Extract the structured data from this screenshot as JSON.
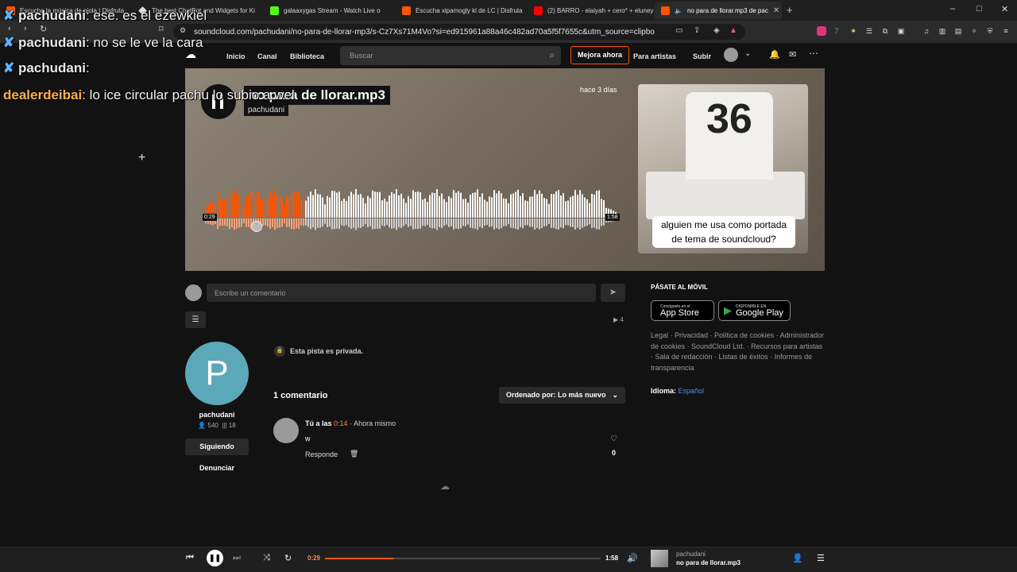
{
  "tabs": [
    {
      "title": "Escucha la música de piola | Disfruta",
      "color": "#ff5500",
      "active": false
    },
    {
      "title": "The best ChatBot and Widgets for Ki",
      "color": "#dddddd",
      "active": false
    },
    {
      "title": "galaaxygas Stream - Watch Live o",
      "color": "#53fc18",
      "active": false
    },
    {
      "title": "Escucha xipamogly kl de LC | Disfruta",
      "color": "#ff5500",
      "active": false
    },
    {
      "title": "(2) BARRO - elaiyah + cero* + eluney",
      "color": "#ff0000",
      "active": false
    },
    {
      "title": "no para de llorar.mp3 de pac",
      "color": "#ff5500",
      "active": true
    }
  ],
  "browser": {
    "new_tab": "+",
    "url": "soundcloud.com/pachudani/no-para-de-llorar-mp3/s-Cz7Xs71M4Vo?si=ed915961a88a46c482ad70a5f5f7655c&utm_source=clipboard&utm_m...",
    "minimize": "–",
    "maximize": "□",
    "close": "✕"
  },
  "header": {
    "nav": [
      "Inicio",
      "Canal",
      "Biblioteca"
    ],
    "search_placeholder": "Buscar",
    "upgrade": "Mejora ahora",
    "for_artists": "Para artistas",
    "upload": "Subir"
  },
  "track": {
    "title": "no para de llorar.mp3",
    "artist": "pachudani",
    "posted": "hace 3 días",
    "elapsed_badge": "0:29",
    "duration_badge": "1:58",
    "progress": 0.25,
    "cover_caption": "alguien me usa como portada de tema de soundcloud?"
  },
  "comment_input": {
    "placeholder": "Escribe un comentario"
  },
  "play_count": "4",
  "profile": {
    "initial": "P",
    "name": "pachudani",
    "followers": "540",
    "tracks": "18",
    "follow_label": "Siguiendo",
    "report_label": "Denunciar"
  },
  "private_notice": "Esta pista es privada.",
  "comments": {
    "count_label": "1 comentario",
    "sort_label": "Ordenado por: Lo más nuevo",
    "items": [
      {
        "author": "Tú a las",
        "time": "0:14",
        "when": "· Ahora mismo",
        "text": "w",
        "reply": "Responde",
        "likes": "0"
      }
    ]
  },
  "sidebar": {
    "mobile_title": "PÁSATE AL MÓVIL",
    "app_store_small": "Consíguelo en el",
    "app_store": "App Store",
    "google_small": "DISPONIBLE EN",
    "google": "Google Play",
    "links": "Legal · Privacidad · Política de cookies · Administrador de cookies · SoundCloud Ltd. · Recursos para artistas · Sala de redacción · Listas de éxitos · Informes de transparencia",
    "language_label": "Idioma:",
    "language": "Español"
  },
  "player": {
    "current": "0:29",
    "total": "1:58",
    "progress": 0.25,
    "artist": "pachudani",
    "title": "no para de llorar.mp3"
  },
  "chat": [
    {
      "user": "pachudani",
      "message": ": ese. es el ezewkiel",
      "badge": true,
      "color": "#e8e8e8"
    },
    {
      "user": "pachudani",
      "message": ": no se le ve la cara",
      "badge": true,
      "color": "#e8e8e8"
    },
    {
      "user": "pachudani",
      "message": ":",
      "badge": true,
      "color": "#e8e8e8"
    },
    {
      "user": "dealerdeibai",
      "message": ": lo ice circular pachu lo subio a wel",
      "badge": false,
      "color": "#ffb04d"
    }
  ]
}
